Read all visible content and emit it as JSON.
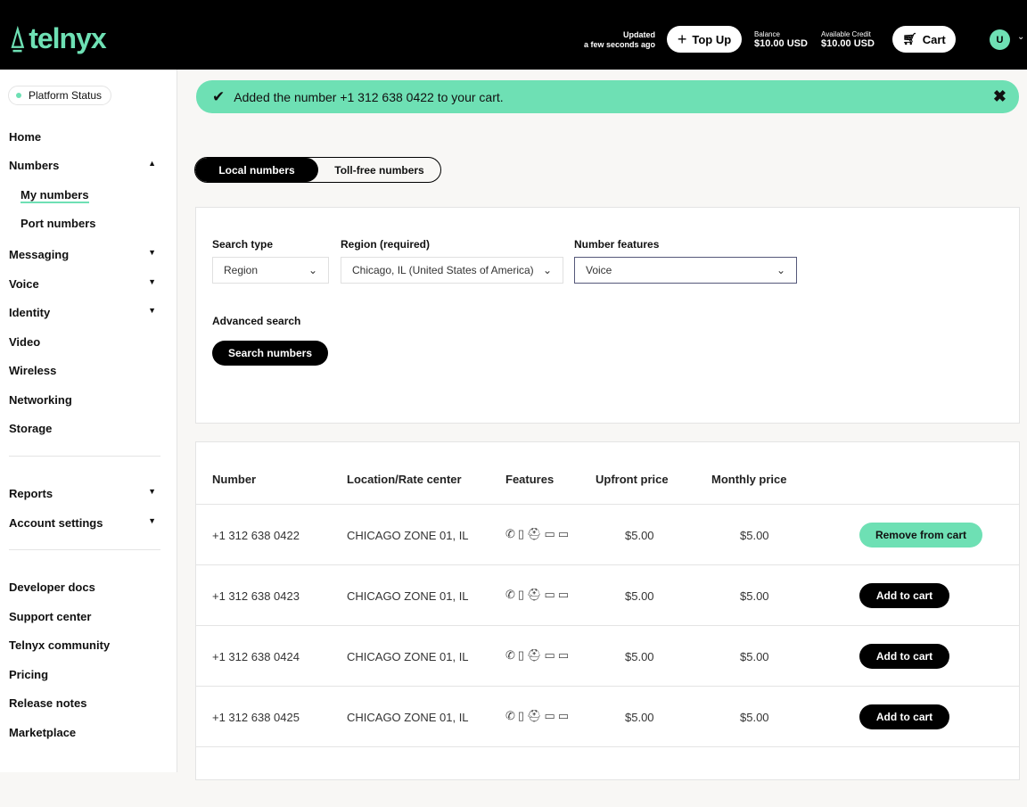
{
  "header": {
    "brand": "telnyx",
    "updated_label": "Updated",
    "updated_time": "a few seconds ago",
    "top_up": "Top Up",
    "balance_label": "Balance",
    "balance": "$10.00 USD",
    "credit_label": "Available Credit",
    "credit": "$10.00 USD",
    "cart": "Cart",
    "avatar": "U"
  },
  "sidebar": {
    "status": "Platform Status",
    "items": [
      {
        "label": "Home"
      },
      {
        "label": "Numbers",
        "caret": "▲"
      },
      {
        "label": "My numbers"
      },
      {
        "label": "Port numbers"
      },
      {
        "label": "Messaging",
        "caret": "▼"
      },
      {
        "label": "Voice",
        "caret": "▼"
      },
      {
        "label": "Identity",
        "caret": "▼"
      },
      {
        "label": "Video"
      },
      {
        "label": "Wireless"
      },
      {
        "label": "Networking"
      },
      {
        "label": "Storage"
      },
      {
        "label": "Reports",
        "caret": "▼"
      },
      {
        "label": "Account settings",
        "caret": "▼"
      },
      {
        "label": "Developer docs"
      },
      {
        "label": "Support center"
      },
      {
        "label": "Telnyx community"
      },
      {
        "label": "Pricing"
      },
      {
        "label": "Release notes"
      },
      {
        "label": "Marketplace"
      }
    ]
  },
  "toast": {
    "message": "Added the number +1 312 638 0422 to your cart.",
    "close": "✖"
  },
  "tabs": [
    "Local numbers",
    "Toll-free numbers"
  ],
  "search": {
    "type_label": "Search type",
    "type_value": "Region",
    "region_label": "Region (required)",
    "region_value": "Chicago, IL (United States of America)",
    "features_label": "Number features",
    "features_value": "Voice",
    "advanced": "Advanced search",
    "submit": "Search numbers"
  },
  "table": {
    "headers": [
      "Number",
      "Location/Rate center",
      "Features",
      "Upfront price",
      "Monthly price"
    ],
    "features_icons": "✆▯⛑▭▭",
    "rows": [
      {
        "number": "+1 312 638 0422",
        "location": "CHICAGO ZONE 01, IL",
        "upfront": "$5.00",
        "monthly": "$5.00",
        "action": "Remove from cart"
      },
      {
        "number": "+1 312 638 0423",
        "location": "CHICAGO ZONE 01, IL",
        "upfront": "$5.00",
        "monthly": "$5.00",
        "action": "Add to cart"
      },
      {
        "number": "+1 312 638 0424",
        "location": "CHICAGO ZONE 01, IL",
        "upfront": "$5.00",
        "monthly": "$5.00",
        "action": "Add to cart"
      },
      {
        "number": "+1 312 638 0425",
        "location": "CHICAGO ZONE 01, IL",
        "upfront": "$5.00",
        "monthly": "$5.00",
        "action": "Add to cart"
      }
    ]
  },
  "colors": {
    "accent": "#6ee0b4"
  }
}
